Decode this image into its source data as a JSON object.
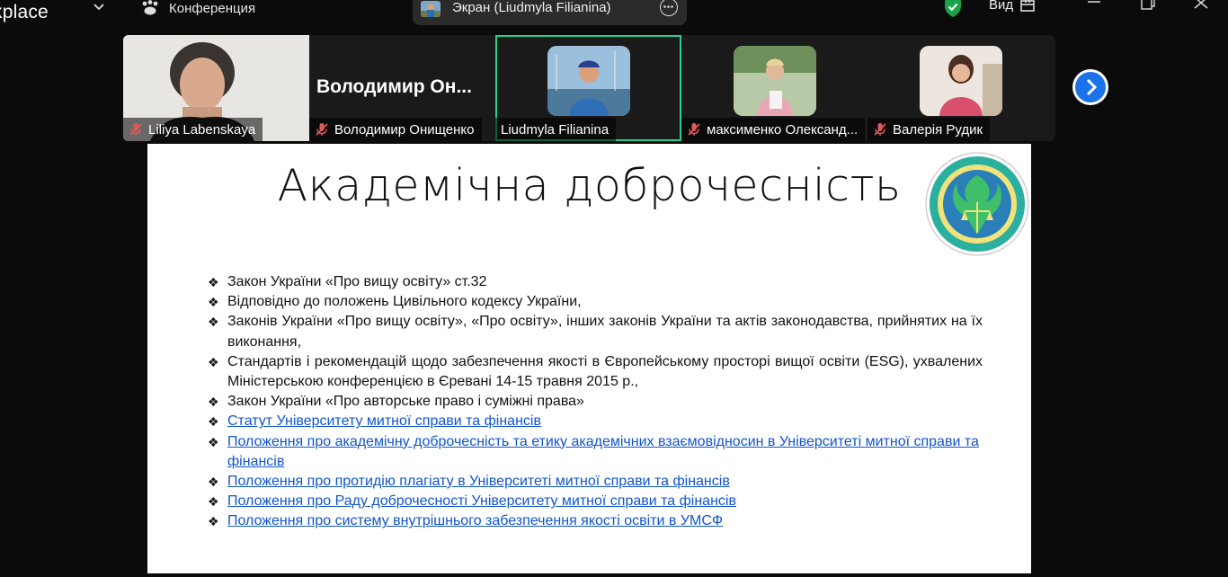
{
  "topbar": {
    "app_title": "kplace",
    "conference_label": "Конференция",
    "share_label": "Экран (Liudmyla Filianina)",
    "view_label": "Вид"
  },
  "gallery": {
    "participants": [
      {
        "name": "Liliya Labenskaya",
        "muted": true
      },
      {
        "name": "Володимир Онищенко",
        "muted": true,
        "big_name": "Володимир  Он..."
      },
      {
        "name": "Liudmyla Filianina",
        "muted": false,
        "active": true
      },
      {
        "name": "максименко Олександ...",
        "muted": true
      },
      {
        "name": "Валерія Рудик",
        "muted": true
      }
    ]
  },
  "slide": {
    "title": "Академічна доброчесність",
    "items": [
      {
        "text": "Закон України «Про вищу освіту» ст.32",
        "link": false
      },
      {
        "text": "Відповідно до положень Цивільного кодексу України,",
        "link": false
      },
      {
        "text": "Законів України «Про вищу освіту», «Про освіту», інших законів України та актів законодавства, прийнятих на їх виконання,",
        "link": false
      },
      {
        "text": "Стандартів і рекомендацій щодо забезпечення якості в Європейському просторі вищої освіти (ESG), ухвалених Міністерською конференцією в Єревані 14-15 травня 2015 р.,",
        "link": false
      },
      {
        "text": "Закон України  «Про авторське право і суміжні права»",
        "link": false
      },
      {
        "text": "Статут Університету митної справи та фінансів",
        "link": true
      },
      {
        "text": "Положення про академічну доброчесність та етику академічних взаємовідносин в Університеті митної справи та фінансів",
        "link": true
      },
      {
        "text": "Положення про протидію плагіату в Університеті митної справи та фінансів",
        "link": true
      },
      {
        "text": "Положення про Раду доброчесності Університету митної справи та фінансів",
        "link": true
      },
      {
        "text": "Положення про систему внутрішнього забезпечення якості освіти в УМСФ",
        "link": true
      }
    ]
  },
  "colors": {
    "active_border": "#23d18b",
    "link": "#1155cc",
    "next_button": "#1a73e8",
    "shield": "#1aa34a"
  },
  "icons": [
    "chevron-down-icon",
    "paw-icon",
    "more-icon",
    "shield-check-icon",
    "view-icon",
    "minimize-icon",
    "restore-icon",
    "close-icon",
    "mic-muted-icon",
    "chevron-right-icon"
  ]
}
